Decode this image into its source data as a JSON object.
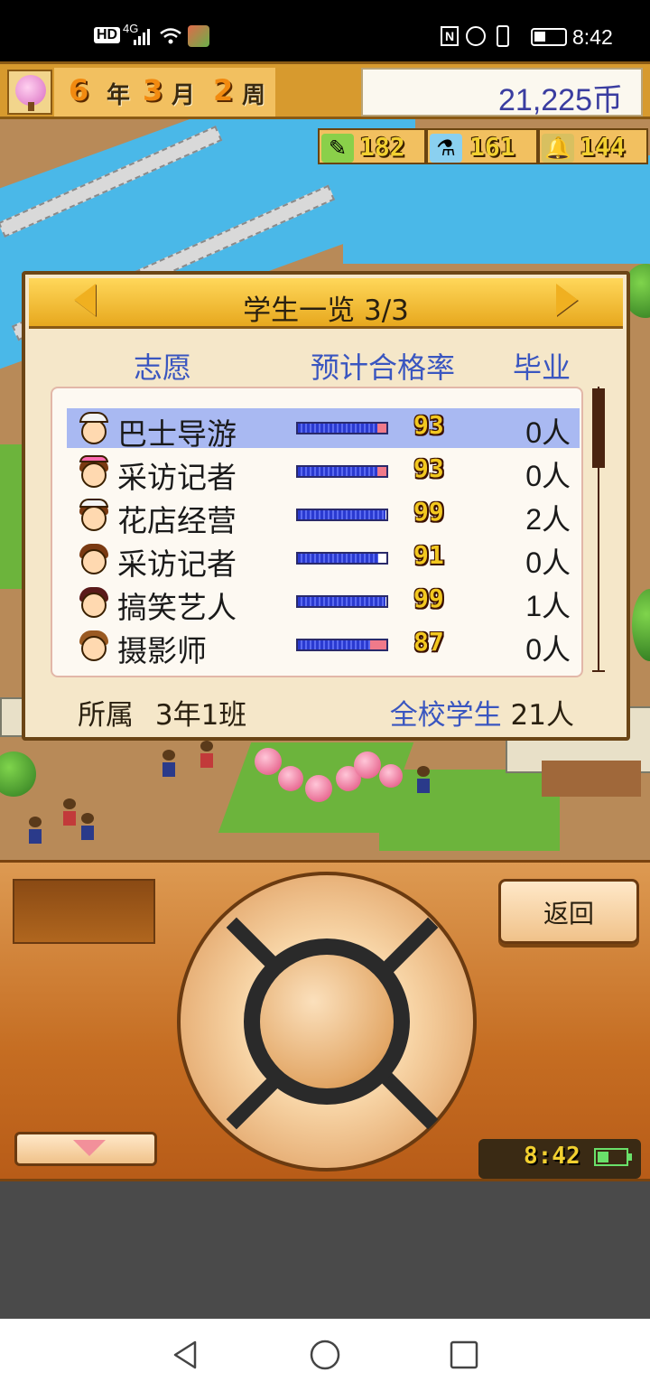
{
  "status_bar": {
    "left_icons": [
      "hd-icon",
      "4g-signal-icon",
      "wifi-icon",
      "app-notification-icon"
    ],
    "right_icons": [
      "nfc-icon",
      "alarm-icon",
      "vibrate-icon",
      "battery-icon"
    ],
    "hd_label": "HD",
    "net_label": "4G",
    "time": "8:42"
  },
  "header": {
    "date": {
      "month_count": "6",
      "year_unit": "年",
      "month": "3",
      "month_unit": "月",
      "week": "2",
      "week_unit": "周"
    },
    "money": "21,225币"
  },
  "stats": [
    {
      "icon": "pencil-icon",
      "value": "182"
    },
    {
      "icon": "flask-icon",
      "value": "161"
    },
    {
      "icon": "bell-icon",
      "value": "144"
    }
  ],
  "student_list": {
    "title": "学生一览 3/3",
    "columns": {
      "career": "志愿",
      "pass_rate": "预计合格率",
      "graduates": "毕业"
    },
    "rows": [
      {
        "career": "巴士导游",
        "pass_rate": 93,
        "graduates": "0人",
        "selected": true
      },
      {
        "career": "采访记者",
        "pass_rate": 93,
        "graduates": "0人",
        "selected": false
      },
      {
        "career": "花店经营",
        "pass_rate": 99,
        "graduates": "2人",
        "selected": false
      },
      {
        "career": "采访记者",
        "pass_rate": 91,
        "graduates": "0人",
        "selected": false
      },
      {
        "career": "搞笑艺人",
        "pass_rate": 99,
        "graduates": "1人",
        "selected": false
      },
      {
        "career": "摄影师",
        "pass_rate": 87,
        "graduates": "0人",
        "selected": false
      }
    ],
    "footer": {
      "class_label": "所属",
      "class_value": "3年1班",
      "total_label": "全校学生",
      "total_value": "21人"
    }
  },
  "controller": {
    "back_label": "返回",
    "clock": "8:42"
  },
  "nav": {
    "icons": [
      "back-triangle-icon",
      "home-circle-icon",
      "recents-square-icon"
    ]
  },
  "colors": {
    "accent_blue": "#3a56c0",
    "panel_bg": "#f5e7c9",
    "selection": "#a9b9f2",
    "controller": "#c56d22"
  }
}
